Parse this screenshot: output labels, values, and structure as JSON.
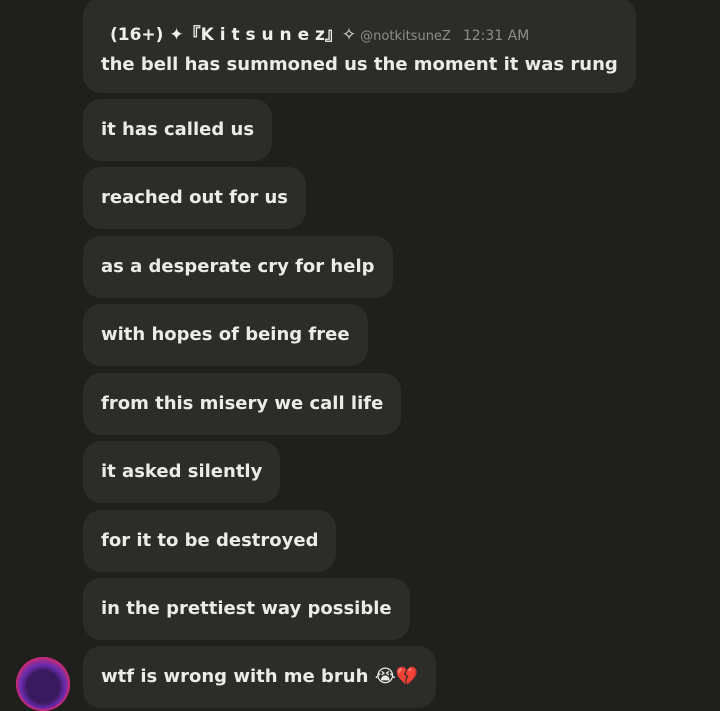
{
  "author": {
    "display_name": "(16+) ✦『K i t s u n e z』✧",
    "handle": "@notkitsuneZ",
    "timestamp": "12:31 AM"
  },
  "messages": [
    {
      "text": "the bell has summoned us the moment it was rung"
    },
    {
      "text": "it has called us"
    },
    {
      "text": "reached out for us"
    },
    {
      "text": "as a desperate cry for help"
    },
    {
      "text": "with hopes of being free"
    },
    {
      "text": "from this misery we call life"
    },
    {
      "text": "it asked silently"
    },
    {
      "text": "for it to be destroyed"
    },
    {
      "text": "in the prettiest way possible"
    },
    {
      "text": "wtf is wrong with me bruh 😭💔"
    }
  ]
}
